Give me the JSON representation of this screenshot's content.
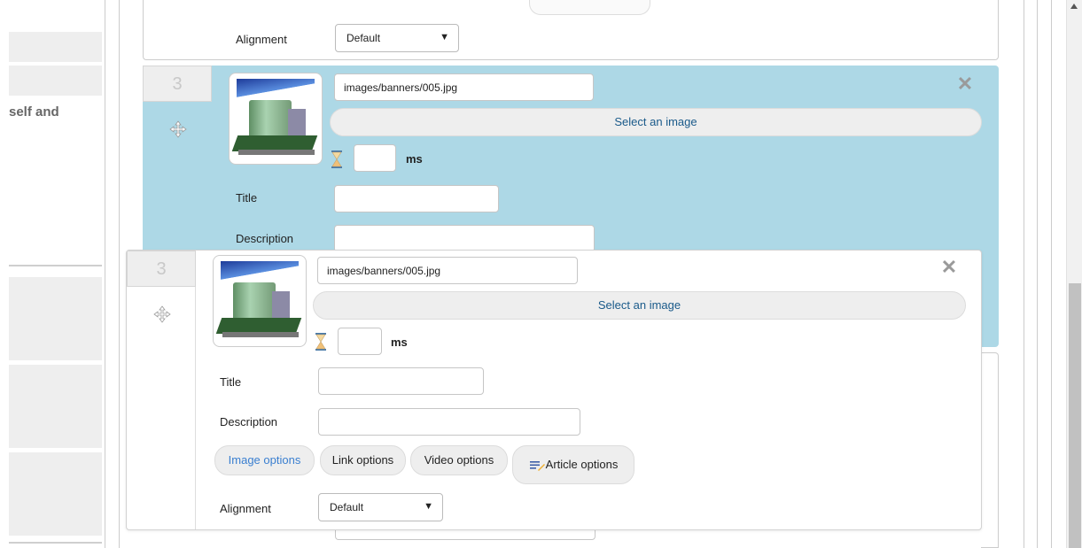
{
  "sidebar": {
    "text": "self and"
  },
  "top_slide": {
    "alignment_label": "Alignment",
    "alignment_value": "Default"
  },
  "slide_blue": {
    "number": "3",
    "image_path": "images/banners/005.jpg",
    "select_image_label": "Select an image",
    "ms_label": "ms",
    "title_label": "Title",
    "description_label": "Description"
  },
  "slide_white": {
    "number": "3",
    "image_path": "images/banners/005.jpg",
    "select_image_label": "Select an image",
    "ms_label": "ms",
    "title_label": "Title",
    "description_label": "Description",
    "tabs": {
      "image": "Image options",
      "link": "Link options",
      "video": "Video options",
      "article": "Article options"
    },
    "alignment_label": "Alignment",
    "alignment_value": "Default"
  },
  "colors": {
    "highlight": "#add8e6",
    "link": "#1a5a8a",
    "active_tab": "#3a7fd0"
  }
}
